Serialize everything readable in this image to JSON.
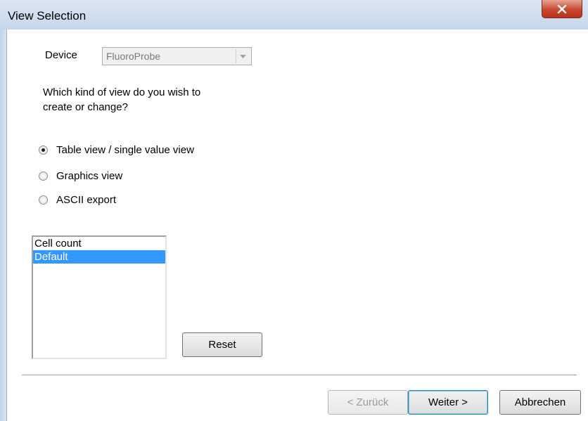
{
  "window": {
    "title": "View Selection",
    "close_label": "X"
  },
  "device": {
    "label": "Device",
    "selected": "FluoroProbe"
  },
  "question": {
    "line1": "Which kind of view do you wish to",
    "line2": "create or change?"
  },
  "view_options": [
    {
      "label": "Table view / single value view",
      "checked": true
    },
    {
      "label": "Graphics view",
      "checked": false
    },
    {
      "label": "ASCII export",
      "checked": false
    }
  ],
  "views_list": [
    {
      "label": "Cell count",
      "selected": false
    },
    {
      "label": "Default",
      "selected": true
    }
  ],
  "buttons": {
    "reset": "Reset",
    "back": "< Zurück",
    "next": "Weiter >",
    "cancel": "Abbrechen"
  },
  "colors": {
    "selection": "#3399ff",
    "close_button": "#c7472f",
    "titlebar": "#dbe6f3"
  }
}
